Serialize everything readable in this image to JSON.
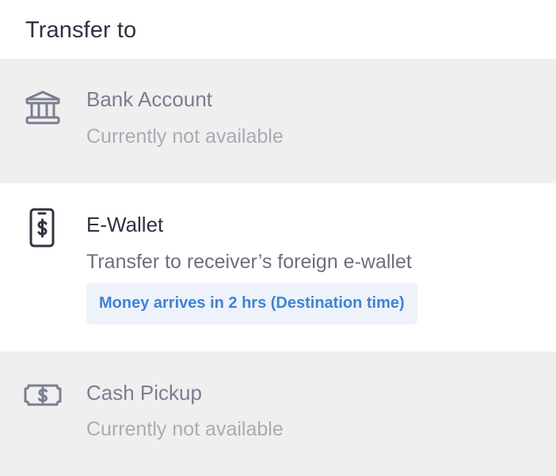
{
  "header": {
    "title": "Transfer to"
  },
  "options": [
    {
      "icon": "bank-icon",
      "title": "Bank Account",
      "subtitle": "Currently not available",
      "enabled": false
    },
    {
      "icon": "e-wallet-icon",
      "title": "E-Wallet",
      "subtitle": "Transfer to receiver’s foreign e-wallet",
      "badge": "Money arrives in 2 hrs (Destination time)",
      "enabled": true
    },
    {
      "icon": "cash-icon",
      "title": "Cash Pickup",
      "subtitle": "Currently not available",
      "enabled": false
    }
  ],
  "colors": {
    "disabled_background": "#efefef",
    "enabled_background": "#ffffff",
    "badge_background": "#eef3fb",
    "badge_text": "#3e83d4",
    "primary_text": "#2f3342",
    "disabled_title": "#7b7e8f",
    "disabled_subtitle": "#a9abb5"
  }
}
